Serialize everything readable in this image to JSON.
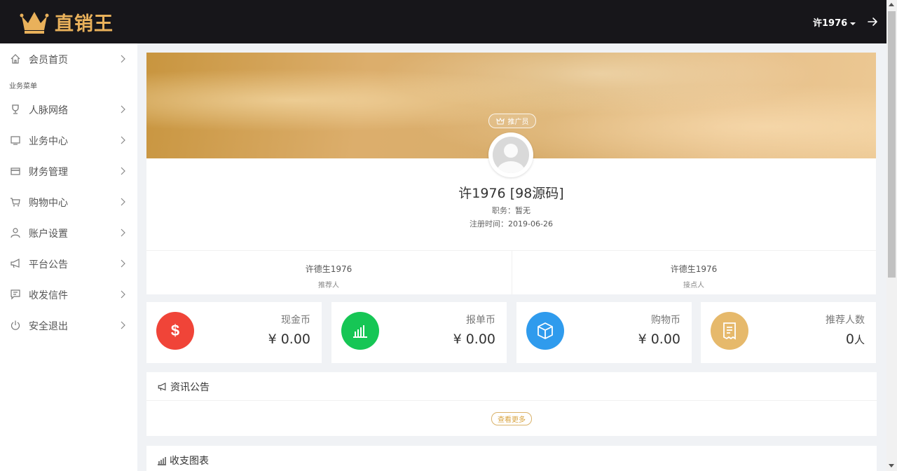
{
  "header": {
    "brand": "直销王",
    "user_name": "许1976"
  },
  "sidebar": {
    "items": [
      {
        "label": "会员首页",
        "icon": "home-icon"
      },
      {
        "label": "人脉网络",
        "icon": "trophy-icon"
      },
      {
        "label": "业务中心",
        "icon": "monitor-icon"
      },
      {
        "label": "财务管理",
        "icon": "card-icon"
      },
      {
        "label": "购物中心",
        "icon": "cart-icon"
      },
      {
        "label": "账户设置",
        "icon": "user-icon"
      },
      {
        "label": "平台公告",
        "icon": "megaphone-icon"
      },
      {
        "label": "收发信件",
        "icon": "message-icon"
      },
      {
        "label": "安全退出",
        "icon": "power-icon"
      }
    ],
    "section_label": "业务菜单"
  },
  "profile": {
    "role_badge": "推广员",
    "display_name": "许1976 [98源码]",
    "position_label": "职务：",
    "position_value": "暂无",
    "register_label": "注册时间：",
    "register_value": "2019-06-26",
    "referrer": {
      "name": "许德生1976",
      "role": "推荐人"
    },
    "node": {
      "name": "许德生1976",
      "role": "接点人"
    }
  },
  "stats": [
    {
      "title": "现金币",
      "value": "¥ 0.00",
      "icon": "dollar-icon",
      "color": "#f04438"
    },
    {
      "title": "报单币",
      "value": "¥ 0.00",
      "icon": "bar-chart-icon",
      "color": "#16c655"
    },
    {
      "title": "购物币",
      "value": "¥ 0.00",
      "icon": "box-icon",
      "color": "#2f9bed"
    },
    {
      "title": "推荐人数",
      "value": "0",
      "unit": "人",
      "icon": "receipt-icon",
      "color": "#e6b96b"
    }
  ],
  "news_panel": {
    "title": "资讯公告",
    "more_label": "查看更多"
  },
  "chart_panel": {
    "title": "收支图表"
  }
}
